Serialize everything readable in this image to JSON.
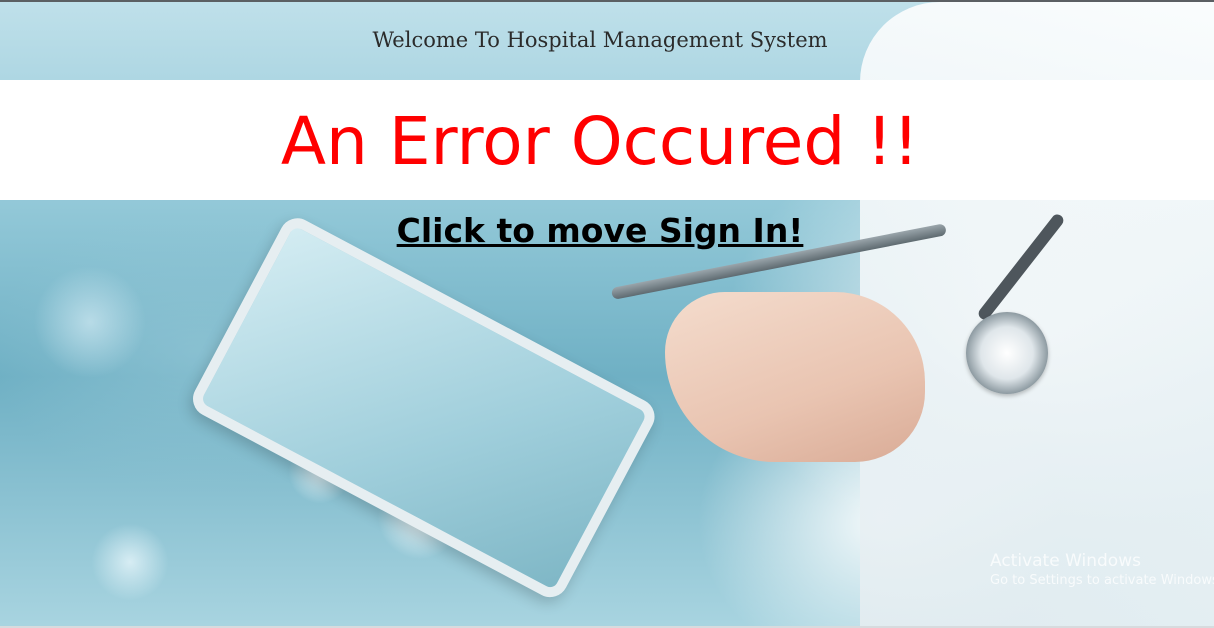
{
  "header": {
    "title": "Welcome To Hospital Management System"
  },
  "main": {
    "error_heading": "An Error Occured !!",
    "signin_link": "Click to move Sign In!"
  },
  "os_watermark": {
    "line1": "Activate Windows",
    "line2": "Go to Settings to activate Windows."
  },
  "colors": {
    "error": "#ff0000",
    "link": "#000000",
    "header_text": "#2b2b2b"
  }
}
